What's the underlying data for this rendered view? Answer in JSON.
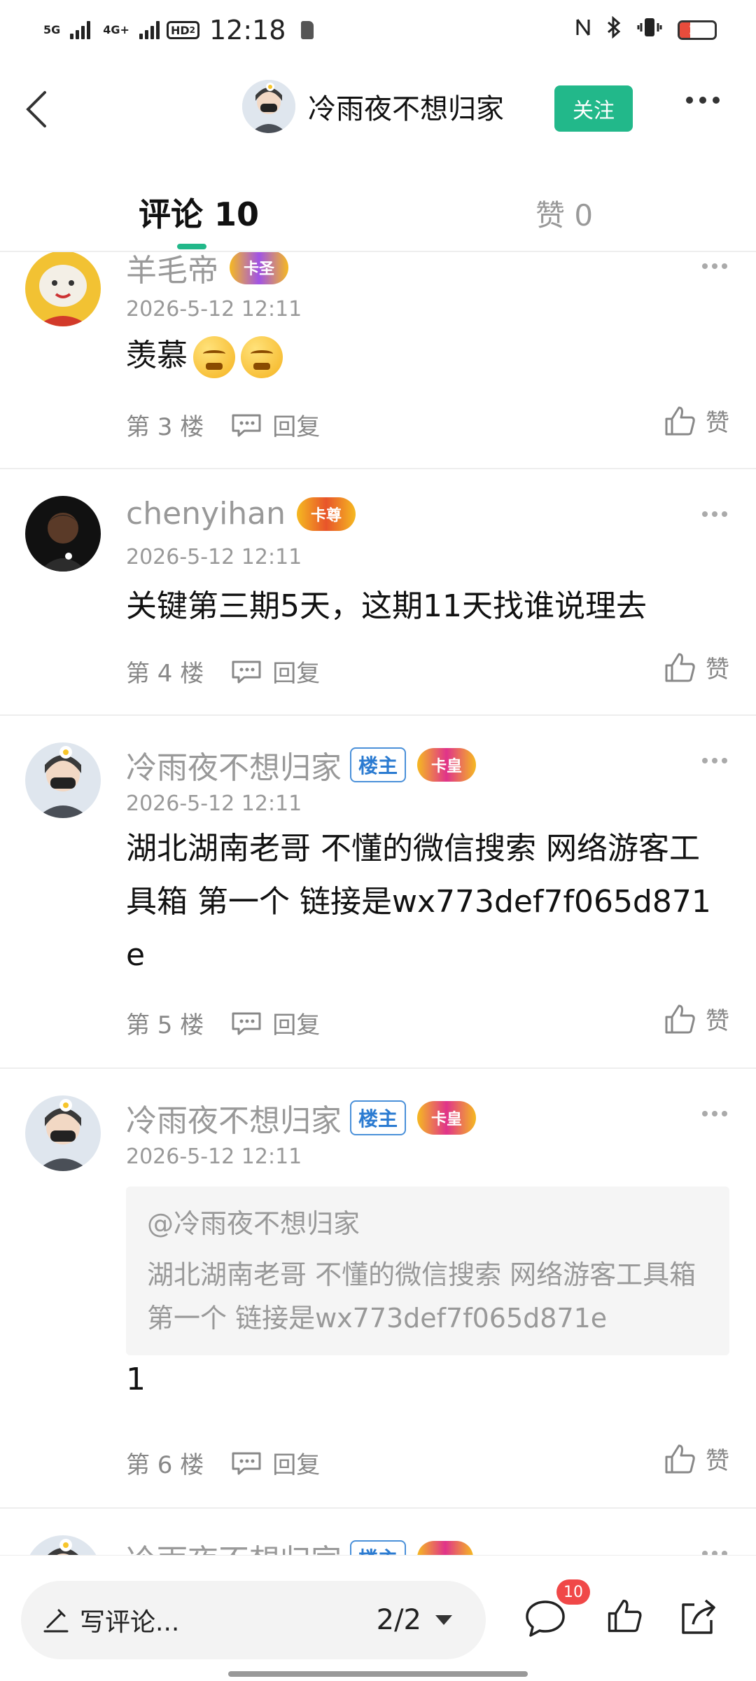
{
  "status_bar": {
    "network_1": "5G",
    "network_2": "4G+",
    "hd_label": "HD",
    "hd_sub": "2",
    "time": "12:18",
    "battery_level": "15",
    "battery_fraction": 0.15
  },
  "header": {
    "author_name": "冷雨夜不想归家",
    "follow_label": "关注"
  },
  "tabs": {
    "comments_label": "评论 10",
    "likes_label": "赞 0"
  },
  "comments": [
    {
      "username": "羊毛帝",
      "badge": "卡圣",
      "time": "2026-5-12 12:11",
      "text": "羡慕",
      "emoji_count": 2,
      "floor": "第 3 楼",
      "reply_label": "回复",
      "like_label": "赞"
    },
    {
      "username": "chenyihan",
      "badge": "卡尊",
      "time": "2026-5-12 12:11",
      "text": "关键第三期5天，这期11天找谁说理去",
      "floor": "第 4 楼",
      "reply_label": "回复",
      "like_label": "赞"
    },
    {
      "username": "冷雨夜不想归家",
      "owner_tag": "楼主",
      "badge": "卡皇",
      "time": "2026-5-12 12:11",
      "text": "湖北湖南老哥 不懂的微信搜索 网络游客工具箱  第一个 链接是wx773def7f065d871e",
      "floor": "第 5 楼",
      "reply_label": "回复",
      "like_label": "赞"
    },
    {
      "username": "冷雨夜不想归家",
      "owner_tag": "楼主",
      "badge": "卡皇",
      "time": "2026-5-12 12:11",
      "quote_author": "@冷雨夜不想归家",
      "quote_text": "湖北湖南老哥 不懂的微信搜索 网络游客工具箱  第一个 链接是wx773def7f065d871e",
      "text": "1",
      "floor": "第 6 楼",
      "reply_label": "回复",
      "like_label": "赞"
    },
    {
      "username": "冷雨夜不想归家",
      "owner_tag": "楼主"
    }
  ],
  "bottom_bar": {
    "input_placeholder": "写评论...",
    "page_indicator": "2/2",
    "comment_count": "10"
  }
}
